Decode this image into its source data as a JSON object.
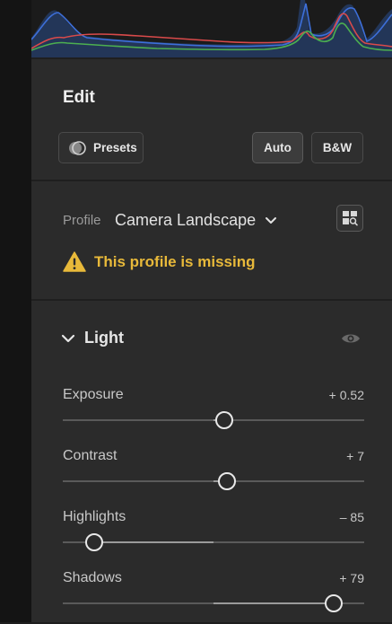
{
  "edit": {
    "title": "Edit",
    "presets_label": "Presets",
    "auto_label": "Auto",
    "bw_label": "B&W"
  },
  "profile": {
    "label": "Profile",
    "value": "Camera Landscape",
    "warning": "This profile is missing"
  },
  "light": {
    "label": "Light",
    "sliders": [
      {
        "name": "Exposure",
        "value": "+ 0.52",
        "position": 0.535
      },
      {
        "name": "Contrast",
        "value": "+ 7",
        "position": 0.545
      },
      {
        "name": "Highlights",
        "value": "– 85",
        "position": 0.105
      },
      {
        "name": "Shadows",
        "value": "+ 79",
        "position": 0.9
      }
    ]
  },
  "colors": {
    "accent_warning": "#e8b93a",
    "panel_bg": "#2b2b2b"
  },
  "icons": [
    "presets-icon",
    "chevron-down-icon",
    "profile-browser-icon",
    "warning-icon",
    "collapse-chevron-icon",
    "visibility-eye-icon"
  ]
}
